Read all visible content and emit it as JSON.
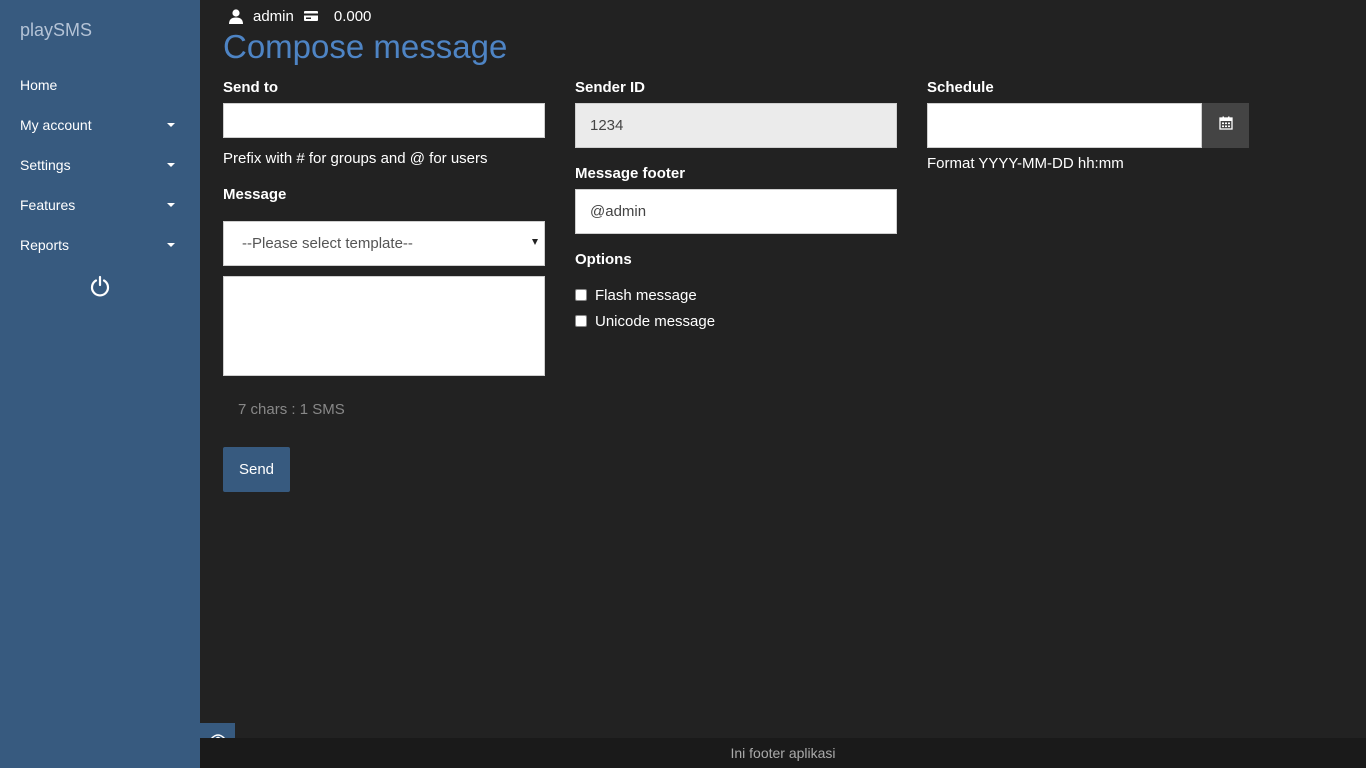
{
  "sidebar": {
    "brand": "playSMS",
    "items": [
      {
        "label": "Home",
        "has_caret": false
      },
      {
        "label": "My account",
        "has_caret": true
      },
      {
        "label": "Settings",
        "has_caret": true
      },
      {
        "label": "Features",
        "has_caret": true
      },
      {
        "label": "Reports",
        "has_caret": true
      }
    ],
    "logout_icon": "power-icon"
  },
  "userbar": {
    "username": "admin",
    "credit": "0.000",
    "user_icon": "user-icon",
    "credit_icon": "credit-card-icon"
  },
  "page": {
    "title": "Compose message"
  },
  "form": {
    "send_to": {
      "label": "Send to",
      "value": "",
      "help": "Prefix with # for groups and @ for users"
    },
    "message": {
      "label": "Message",
      "template_select": "--Please select template--",
      "text": "",
      "counter": "7 chars : 1 SMS"
    },
    "sender_id": {
      "label": "Sender ID",
      "value": "1234"
    },
    "message_footer": {
      "label": "Message footer",
      "value": "@admin"
    },
    "options": {
      "label": "Options",
      "flash": {
        "label": "Flash message",
        "checked": false
      },
      "unicode": {
        "label": "Unicode message",
        "checked": false
      }
    },
    "schedule": {
      "label": "Schedule",
      "value": "",
      "help": "Format YYYY-MM-DD hh:mm",
      "calendar_icon": "calendar-icon"
    },
    "send_label": "Send"
  },
  "footer": {
    "text": "Ini footer aplikasi"
  },
  "colors": {
    "sidebar_bg": "#375a7f",
    "page_bg": "#222222",
    "title": "#4e84c4",
    "button_bg": "#375a7f"
  }
}
